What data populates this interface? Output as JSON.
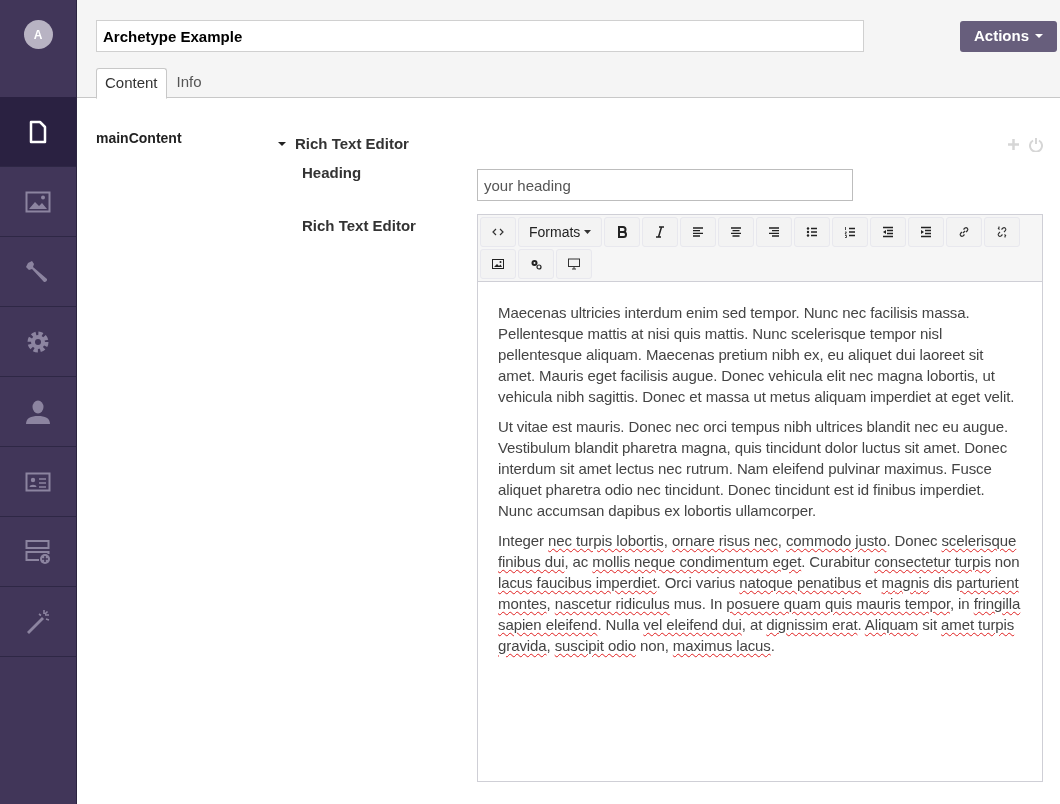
{
  "sidebar": {
    "avatar": "A",
    "items": [
      {
        "selected": true
      },
      {
        "selected": false
      },
      {
        "selected": false
      },
      {
        "selected": false
      },
      {
        "selected": false
      },
      {
        "selected": false
      },
      {
        "selected": false
      },
      {
        "selected": false
      }
    ]
  },
  "header": {
    "title_value": "Archetype Example",
    "actions_label": "Actions",
    "tabs": [
      {
        "label": "Content",
        "selected": true
      },
      {
        "label": "Info",
        "selected": false
      }
    ]
  },
  "property": {
    "label": "mainContent",
    "fieldset": {
      "title": "Rich Text Editor",
      "expanded": true,
      "fields": [
        {
          "kind": "text",
          "label": "Heading",
          "placeholder": "your heading"
        },
        {
          "kind": "rte",
          "label": "Rich Text Editor",
          "formats_label": "Formats",
          "paragraphs": [
            [
              {
                "text": "Maecenas ultricies interdum enim sed tempor. Nunc nec facilisis massa. Pellentesque mattis at nisi quis mattis. Nunc scelerisque tempor nisl pellentesque aliquam. Maecenas pretium nibh ex, eu aliquet dui laoreet sit amet. Mauris eget facilisis augue. Donec vehicula elit nec magna lobortis, ut vehicula nibh sagittis. Donec et massa ut metus aliquam imperdiet at eget velit.",
                "misspelled": false
              }
            ],
            [
              {
                "text": "Ut vitae est mauris. Donec nec orci tempus nibh ultrices blandit nec eu augue. Vestibulum blandit pharetra magna, quis tincidunt dolor luctus sit amet. Donec interdum sit amet lectus nec rutrum. Nam eleifend pulvinar maximus. Fusce aliquet pharetra odio nec tincidunt. Donec tincidunt est id finibus imperdiet. Nunc accumsan dapibus ex lobortis ullamcorper.",
                "misspelled": false
              }
            ],
            [
              {
                "text": "Integer ",
                "misspelled": false
              },
              {
                "text": "nec turpis lobortis",
                "misspelled": true
              },
              {
                "text": ", ",
                "misspelled": false
              },
              {
                "text": "ornare risus nec",
                "misspelled": true
              },
              {
                "text": ", ",
                "misspelled": false
              },
              {
                "text": "commodo justo",
                "misspelled": true
              },
              {
                "text": ". Donec ",
                "misspelled": false
              },
              {
                "text": "scelerisque finibus dui",
                "misspelled": true
              },
              {
                "text": ", ac ",
                "misspelled": false
              },
              {
                "text": "mollis neque condimentum eget",
                "misspelled": true
              },
              {
                "text": ". Curabitur ",
                "misspelled": false
              },
              {
                "text": "consectetur turpis",
                "misspelled": true
              },
              {
                "text": " non ",
                "misspelled": false
              },
              {
                "text": "lacus faucibus imperdiet",
                "misspelled": true
              },
              {
                "text": ". Orci varius ",
                "misspelled": false
              },
              {
                "text": "natoque penatibus",
                "misspelled": true
              },
              {
                "text": " et ",
                "misspelled": false
              },
              {
                "text": "magnis",
                "misspelled": true
              },
              {
                "text": " dis ",
                "misspelled": false
              },
              {
                "text": "parturient montes",
                "misspelled": true
              },
              {
                "text": ", ",
                "misspelled": false
              },
              {
                "text": "nascetur ridiculus",
                "misspelled": true
              },
              {
                "text": " mus. In ",
                "misspelled": false
              },
              {
                "text": "posuere quam quis mauris tempor",
                "misspelled": true
              },
              {
                "text": ", in ",
                "misspelled": false
              },
              {
                "text": "fringilla sapien eleifend",
                "misspelled": true
              },
              {
                "text": ". Nulla ",
                "misspelled": false
              },
              {
                "text": "vel eleifend dui",
                "misspelled": true
              },
              {
                "text": ", at ",
                "misspelled": false
              },
              {
                "text": "dignissim erat",
                "misspelled": true
              },
              {
                "text": ". ",
                "misspelled": false
              },
              {
                "text": "Aliquam",
                "misspelled": true
              },
              {
                "text": " sit ",
                "misspelled": false
              },
              {
                "text": "amet turpis gravida",
                "misspelled": true
              },
              {
                "text": ", ",
                "misspelled": false
              },
              {
                "text": "suscipit odio",
                "misspelled": true
              },
              {
                "text": " non, ",
                "misspelled": false
              },
              {
                "text": "maximus lacus",
                "misspelled": true
              },
              {
                "text": ".",
                "misspelled": false
              }
            ]
          ]
        }
      ]
    }
  }
}
